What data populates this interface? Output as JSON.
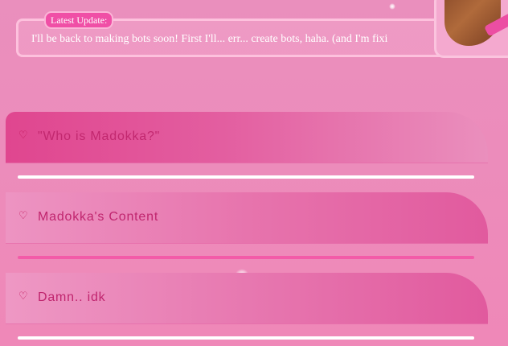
{
  "update": {
    "badge": "Latest Update:",
    "text": "I'll be back to making bots soon! First I'll... err... create bots, haha. (and I'm fixi"
  },
  "sections": [
    {
      "label": "\"Who is Madokka?\"",
      "icon": "heart-outline-icon"
    },
    {
      "label": "Madokka's Content",
      "icon": "heart-outline-icon"
    },
    {
      "label": "Damn.. idk",
      "icon": "heart-outline-icon"
    }
  ],
  "colors": {
    "background": "#ec8cbb",
    "accent": "#e0468f",
    "badge": "#f04fa6",
    "label": "#c0256e"
  }
}
